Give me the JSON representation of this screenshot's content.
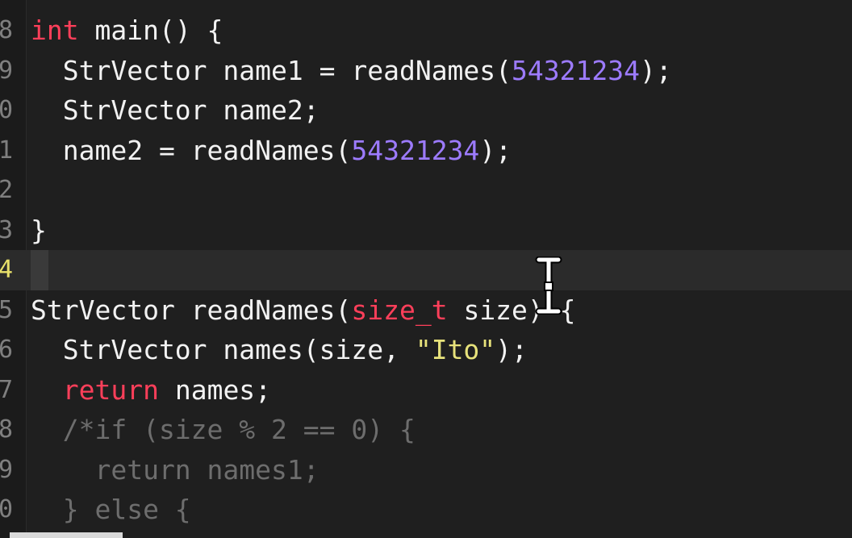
{
  "editor": {
    "lines": [
      {
        "number": "8",
        "tokens": [
          [
            "kw",
            "int"
          ],
          [
            "plain",
            " main() {"
          ]
        ]
      },
      {
        "number": "9",
        "tokens": [
          [
            "plain",
            "  StrVector name1 = readNames("
          ],
          [
            "num",
            "54321234"
          ],
          [
            "plain",
            ");"
          ]
        ]
      },
      {
        "number": "0",
        "tokens": [
          [
            "plain",
            "  StrVector name2;"
          ]
        ]
      },
      {
        "number": "1",
        "tokens": [
          [
            "plain",
            "  name2 = readNames("
          ],
          [
            "num",
            "54321234"
          ],
          [
            "plain",
            ");"
          ]
        ]
      },
      {
        "number": "2",
        "tokens": [
          [
            "plain",
            ""
          ]
        ]
      },
      {
        "number": "3",
        "tokens": [
          [
            "plain",
            "}"
          ]
        ]
      },
      {
        "number": "4",
        "tokens": [
          [
            "plain",
            ""
          ]
        ],
        "current": true
      },
      {
        "number": "5",
        "tokens": [
          [
            "plain",
            "StrVector readNames("
          ],
          [
            "kw",
            "size_t"
          ],
          [
            "plain",
            " size) {"
          ]
        ]
      },
      {
        "number": "6",
        "tokens": [
          [
            "plain",
            "  StrVector names(size, "
          ],
          [
            "str",
            "\"Ito\""
          ],
          [
            "plain",
            ");"
          ]
        ]
      },
      {
        "number": "7",
        "tokens": [
          [
            "plain",
            "  "
          ],
          [
            "kw",
            "return"
          ],
          [
            "plain",
            " names;"
          ]
        ]
      },
      {
        "number": "8",
        "tokens": [
          [
            "cmt",
            "  /*if (size % 2 == 0) {"
          ]
        ]
      },
      {
        "number": "9",
        "tokens": [
          [
            "cmt",
            "    return names1;"
          ]
        ]
      },
      {
        "number": "0",
        "tokens": [
          [
            "cmt",
            "  } else {"
          ]
        ]
      }
    ]
  },
  "colors": {
    "background": "#1f1f1f",
    "keyword": "#ff3f5a",
    "number": "#9d7bff",
    "string": "#e7e27b",
    "comment": "#6d6d6d",
    "text": "#f2f2f2",
    "current_line_number": "#e8e06a"
  },
  "cursor": {
    "icon": "i-beam-cursor-icon"
  }
}
